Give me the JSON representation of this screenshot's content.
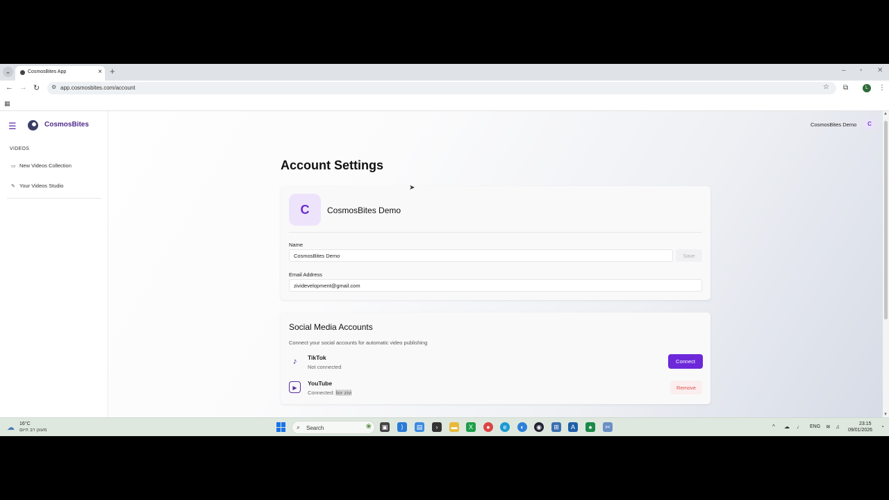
{
  "browser": {
    "tab_title": "CosmosBites App",
    "url": "app.cosmosbites.com/account",
    "profile_initial": "L"
  },
  "app": {
    "brand": "CosmosBites",
    "user_name": "CosmosBites Demo",
    "user_initial": "C",
    "accent_color": "#6d28d9"
  },
  "sidebar": {
    "section_label": "VIDEOS",
    "items": [
      {
        "label": "New Videos Collection",
        "icon": "video-camera-icon"
      },
      {
        "label": "Your Videos Studio",
        "icon": "edit-icon"
      }
    ]
  },
  "page": {
    "title": "Account Settings"
  },
  "profile": {
    "avatar_initial": "C",
    "display_name": "CosmosBites Demo",
    "name_label": "Name",
    "name_value": "CosmosBites Demo",
    "save_label": "Save",
    "email_label": "Email Address",
    "email_value": "zividevelopment@gmail.com"
  },
  "social": {
    "title": "Social Media Accounts",
    "description": "Connect your social accounts for automatic video publishing",
    "accounts": [
      {
        "name": "TikTok",
        "status": "Not connected",
        "action": "Connect",
        "icon": "tiktok-icon"
      },
      {
        "name": "YouTube",
        "status_prefix": "Connected: ",
        "status_user": "lior zivi",
        "action": "Remove",
        "icon": "youtube-icon"
      }
    ]
  },
  "taskbar": {
    "weather_temp": "16°C",
    "weather_desc": "מעונן רב היום",
    "search_label": "Search",
    "language": "ENG",
    "time": "23:15",
    "date": "09/01/2026"
  }
}
